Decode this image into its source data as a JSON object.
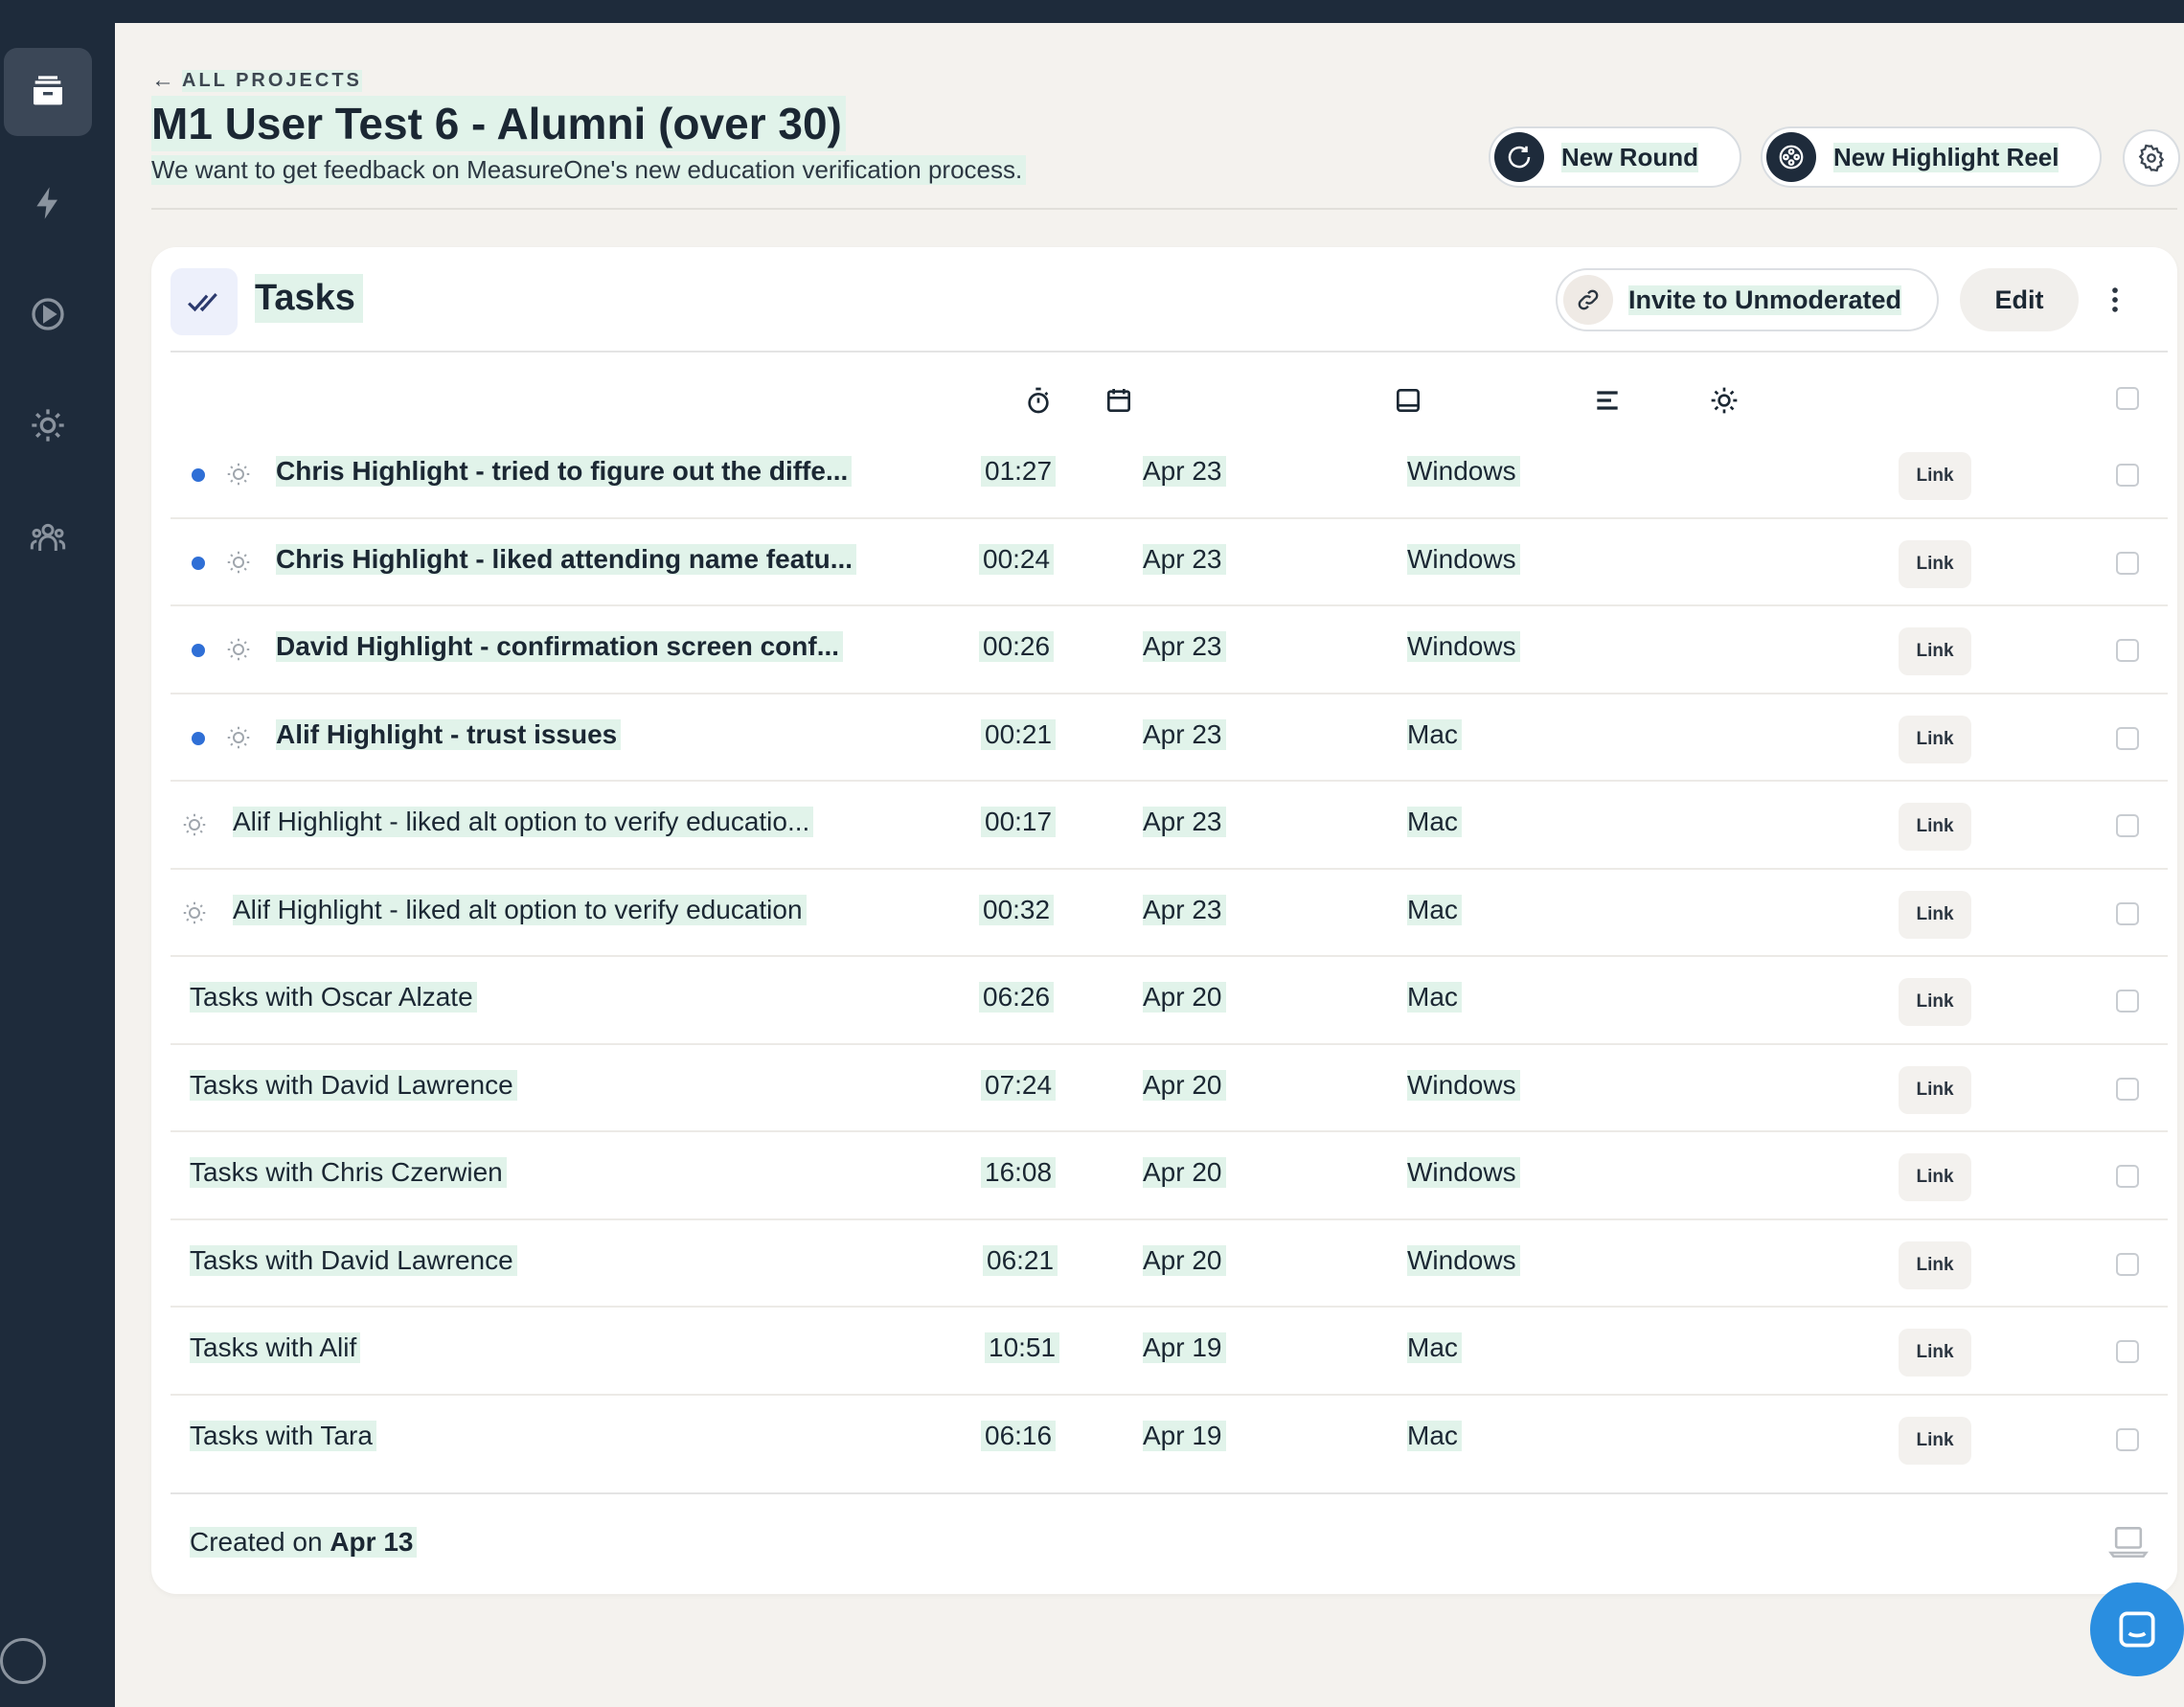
{
  "header": {
    "back_label": "ALL PROJECTS",
    "title": "M1 User Test 6 - Alumni (over 30)",
    "subtitle": "We want to get feedback on MeasureOne's new education verification process.",
    "new_round_label": "New Round",
    "new_reel_label": "New Highlight Reel"
  },
  "card": {
    "title": "Tasks",
    "invite_label": "Invite to Unmoderated",
    "edit_label": "Edit",
    "footer_prefix": "Created on",
    "footer_date": "Apr 13"
  },
  "rows": [
    {
      "title": "Chris Highlight - tried to figure out the diffe...",
      "duration": "01:27",
      "date": "Apr 23",
      "os": "Windows",
      "link": "Link"
    },
    {
      "title": "Chris Highlight - liked attending name featu...",
      "duration": "00:24",
      "date": "Apr 23",
      "os": "Windows",
      "link": "Link"
    },
    {
      "title": "David Highlight - confirmation screen conf...",
      "duration": "00:26",
      "date": "Apr 23",
      "os": "Windows",
      "link": "Link"
    },
    {
      "title": "Alif Highlight - trust issues",
      "duration": "00:21",
      "date": "Apr 23",
      "os": "Mac",
      "link": "Link"
    },
    {
      "title": "Alif Highlight - liked alt option to verify educatio...",
      "duration": "00:17",
      "date": "Apr 23",
      "os": "Mac",
      "link": "Link"
    },
    {
      "title": "Alif Highlight - liked alt option to verify education",
      "duration": "00:32",
      "date": "Apr 23",
      "os": "Mac",
      "link": "Link"
    },
    {
      "title": "Tasks with Oscar Alzate",
      "duration": "06:26",
      "date": "Apr 20",
      "os": "Mac",
      "link": "Link"
    },
    {
      "title": "Tasks with David Lawrence",
      "duration": "07:24",
      "date": "Apr 20",
      "os": "Windows",
      "link": "Link"
    },
    {
      "title": "Tasks with Chris Czerwien",
      "duration": "16:08",
      "date": "Apr 20",
      "os": "Windows",
      "link": "Link"
    },
    {
      "title": "Tasks with David Lawrence",
      "duration": "06:21",
      "date": "Apr 20",
      "os": "Windows",
      "link": "Link"
    },
    {
      "title": "Tasks with Alif",
      "duration": "10:51",
      "date": "Apr 19",
      "os": "Mac",
      "link": "Link"
    },
    {
      "title": "Tasks with Tara",
      "duration": "06:16",
      "date": "Apr 19",
      "os": "Mac",
      "link": "Link"
    }
  ],
  "icons": {
    "sidebar": [
      "archive-icon",
      "lightning-icon",
      "play-icon",
      "sun-icon",
      "users-icon"
    ],
    "columns": [
      "stopwatch-icon",
      "calendar-icon",
      "device-icon",
      "align-left-icon",
      "sun-icon"
    ]
  },
  "colors": {
    "sidebar": "#1e2b3b",
    "highlight": "#e1f3ea",
    "unread_dot": "#2f6fd6",
    "chat": "#2a8ee0"
  }
}
